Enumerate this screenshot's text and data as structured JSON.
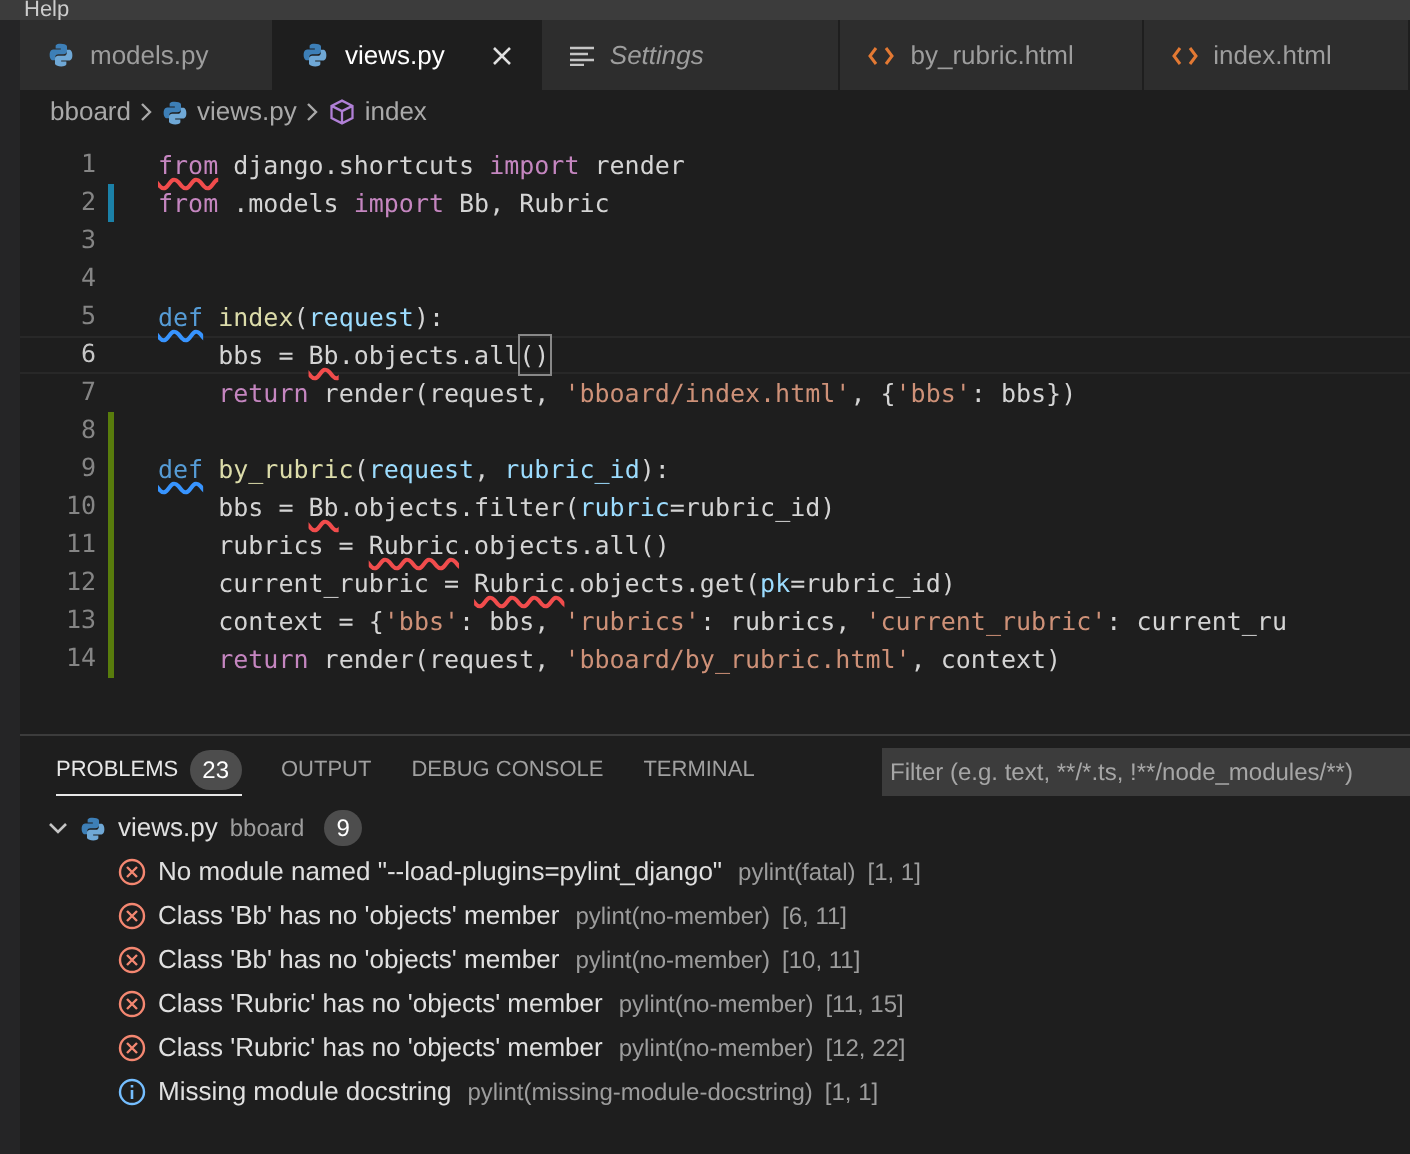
{
  "menu_bar": {
    "items": [
      "Help"
    ]
  },
  "tabs": [
    {
      "label": "models.py",
      "kind": "python",
      "selected": false,
      "preview": false
    },
    {
      "label": "views.py",
      "kind": "python",
      "selected": true,
      "preview": false
    },
    {
      "label": "Settings",
      "kind": "settings",
      "selected": false,
      "preview": true
    },
    {
      "label": "by_rubric.html",
      "kind": "html",
      "selected": false,
      "preview": false
    },
    {
      "label": "index.html",
      "kind": "html",
      "selected": false,
      "preview": false
    }
  ],
  "breadcrumbs": [
    {
      "label": "bboard",
      "kind": "folder"
    },
    {
      "label": "views.py",
      "kind": "python"
    },
    {
      "label": "index",
      "kind": "symbol"
    }
  ],
  "editor": {
    "lines": [
      {
        "number": "1",
        "current": false,
        "modified": false,
        "added": false,
        "tokens": [
          {
            "text": "from",
            "kind": "keyword",
            "error": true
          },
          {
            "text": " django.shortcuts ",
            "kind": "plain"
          },
          {
            "text": "import",
            "kind": "keyword"
          },
          {
            "text": " render",
            "kind": "plain"
          }
        ]
      },
      {
        "number": "2",
        "current": false,
        "modified": true,
        "added": false,
        "tokens": [
          {
            "text": "from",
            "kind": "keyword"
          },
          {
            "text": " .models ",
            "kind": "plain"
          },
          {
            "text": "import",
            "kind": "keyword"
          },
          {
            "text": " Bb, Rubric",
            "kind": "plain"
          }
        ]
      },
      {
        "number": "3",
        "current": false,
        "modified": false,
        "added": false
      },
      {
        "number": "4",
        "current": false,
        "modified": false,
        "added": false
      },
      {
        "number": "5",
        "current": false,
        "modified": false,
        "added": false,
        "tokens": [
          {
            "text": "def",
            "kind": "storage",
            "hint": true
          },
          {
            "text": " index",
            "kind": "function"
          },
          {
            "text": "(",
            "kind": "plain"
          },
          {
            "text": "request",
            "kind": "parameter"
          },
          {
            "text": "):",
            "kind": "plain"
          }
        ]
      },
      {
        "number": "6",
        "current": true,
        "modified": false,
        "added": false,
        "tokens": [
          {
            "text": "    bbs = ",
            "kind": "plain"
          },
          {
            "text": "Bb",
            "kind": "plain",
            "error": true
          },
          {
            "text": ".objects.all",
            "kind": "plain"
          },
          {
            "text": "()",
            "kind": "bracket"
          }
        ]
      },
      {
        "number": "7",
        "current": false,
        "modified": false,
        "added": false,
        "tokens": [
          {
            "text": "    return",
            "kind": "keyword"
          },
          {
            "text": " render(request, ",
            "kind": "plain"
          },
          {
            "text": "'bboard/index.html'",
            "kind": "string"
          },
          {
            "text": ", {",
            "kind": "plain"
          },
          {
            "text": "'bbs'",
            "kind": "string"
          },
          {
            "text": ": bbs})",
            "kind": "plain"
          }
        ]
      },
      {
        "number": "8",
        "current": false,
        "modified": false,
        "added": true
      },
      {
        "number": "9",
        "current": false,
        "modified": false,
        "added": true,
        "tokens": [
          {
            "text": "def",
            "kind": "storage",
            "hint": true
          },
          {
            "text": " by_rubric",
            "kind": "function"
          },
          {
            "text": "(",
            "kind": "plain"
          },
          {
            "text": "request",
            "kind": "parameter"
          },
          {
            "text": ", ",
            "kind": "plain"
          },
          {
            "text": "rubric_id",
            "kind": "parameter"
          },
          {
            "text": "):",
            "kind": "plain"
          }
        ]
      },
      {
        "number": "10",
        "current": false,
        "modified": false,
        "added": true,
        "tokens": [
          {
            "text": "    bbs = ",
            "kind": "plain"
          },
          {
            "text": "Bb",
            "kind": "plain",
            "error": true
          },
          {
            "text": ".objects.filter(",
            "kind": "plain"
          },
          {
            "text": "rubric",
            "kind": "parameter"
          },
          {
            "text": "=rubric_id)",
            "kind": "plain"
          }
        ]
      },
      {
        "number": "11",
        "current": false,
        "modified": false,
        "added": true,
        "tokens": [
          {
            "text": "    rubrics = ",
            "kind": "plain"
          },
          {
            "text": "Rubric",
            "kind": "plain",
            "error": true
          },
          {
            "text": ".objects.all()",
            "kind": "plain"
          }
        ]
      },
      {
        "number": "12",
        "current": false,
        "modified": false,
        "added": true,
        "tokens": [
          {
            "text": "    current_rubric = ",
            "kind": "plain"
          },
          {
            "text": "Rubric",
            "kind": "plain",
            "error": true
          },
          {
            "text": ".objects.get(",
            "kind": "plain"
          },
          {
            "text": "pk",
            "kind": "parameter"
          },
          {
            "text": "=rubric_id)",
            "kind": "plain"
          }
        ]
      },
      {
        "number": "13",
        "current": false,
        "modified": false,
        "added": true,
        "tokens": [
          {
            "text": "    context = {",
            "kind": "plain"
          },
          {
            "text": "'bbs'",
            "kind": "string"
          },
          {
            "text": ": bbs, ",
            "kind": "plain"
          },
          {
            "text": "'rubrics'",
            "kind": "string"
          },
          {
            "text": ": rubrics, ",
            "kind": "plain"
          },
          {
            "text": "'current_rubric'",
            "kind": "string"
          },
          {
            "text": ": current_ru",
            "kind": "plain"
          }
        ]
      },
      {
        "number": "14",
        "current": false,
        "modified": false,
        "added": true,
        "tokens": [
          {
            "text": "    return",
            "kind": "keyword"
          },
          {
            "text": " render(request, ",
            "kind": "plain"
          },
          {
            "text": "'bboard/by_rubric.html'",
            "kind": "string"
          },
          {
            "text": ", context)",
            "kind": "plain"
          }
        ]
      }
    ]
  },
  "panel": {
    "tabs": [
      {
        "label": "PROBLEMS",
        "badge": "23",
        "selected": true
      },
      {
        "label": "OUTPUT",
        "selected": false
      },
      {
        "label": "DEBUG CONSOLE",
        "selected": false
      },
      {
        "label": "TERMINAL",
        "selected": false
      }
    ],
    "filter": {
      "placeholder": "Filter (e.g. text, **/*.ts, !**/node_modules/**)"
    },
    "groups": [
      {
        "file": "views.py",
        "folder": "bboard",
        "count": "9",
        "expanded": true,
        "problems": [
          {
            "kind": "error",
            "message": "No module named \"--load-plugins=pylint_django\"",
            "source": "pylint(fatal)",
            "position": "[1, 1]"
          },
          {
            "kind": "error",
            "message": "Class 'Bb' has no 'objects' member",
            "source": "pylint(no-member)",
            "position": "[6, 11]"
          },
          {
            "kind": "error",
            "message": "Class 'Bb' has no 'objects' member",
            "source": "pylint(no-member)",
            "position": "[10, 11]"
          },
          {
            "kind": "error",
            "message": "Class 'Rubric' has no 'objects' member",
            "source": "pylint(no-member)",
            "position": "[11, 15]"
          },
          {
            "kind": "error",
            "message": "Class 'Rubric' has no 'objects' member",
            "source": "pylint(no-member)",
            "position": "[12, 22]"
          },
          {
            "kind": "info",
            "message": "Missing module docstring",
            "source": "pylint(missing-module-docstring)",
            "position": "[1, 1]"
          }
        ]
      }
    ]
  }
}
